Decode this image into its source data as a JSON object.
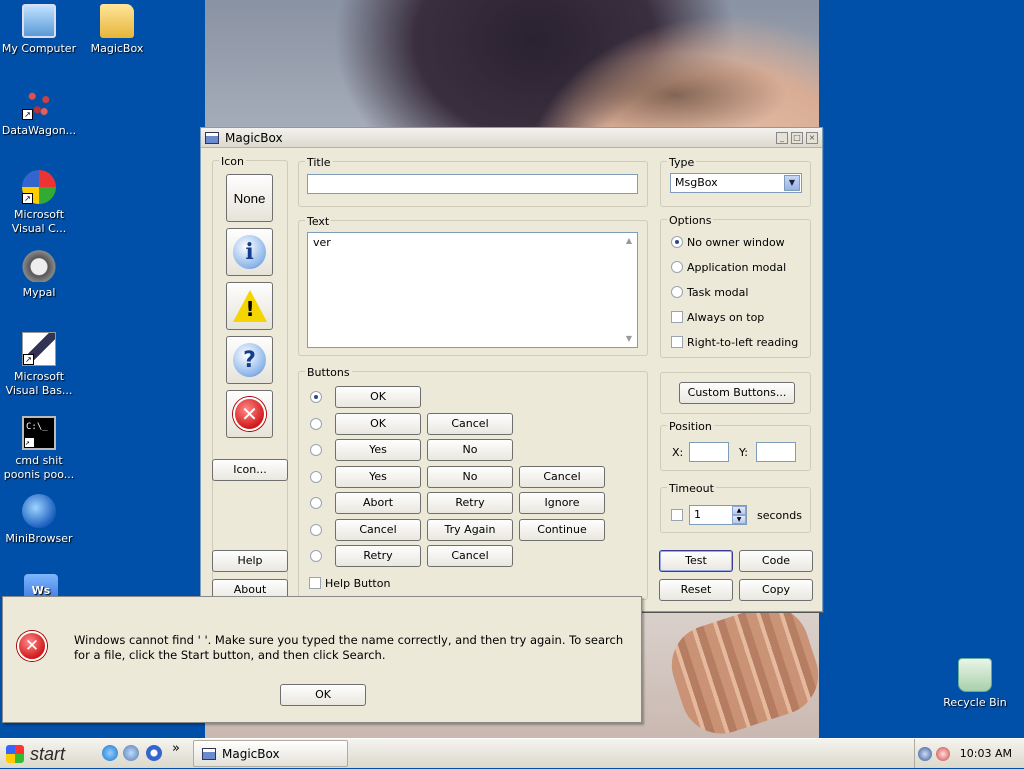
{
  "desktop": {
    "icons": [
      {
        "label": "My Computer",
        "icon": "computer-icon"
      },
      {
        "label": "MagicBox",
        "icon": "folder-icon"
      },
      {
        "label": "DataWagon...",
        "icon": "datawagon-icon"
      },
      {
        "label": "Microsoft Visual C...",
        "icon": "msvc-icon"
      },
      {
        "label": "Mypal",
        "icon": "mypal-icon"
      },
      {
        "label": "Microsoft Visual Bas...",
        "icon": "vb-icon"
      },
      {
        "label": "cmd shit poonis poo...",
        "icon": "cmd-icon"
      },
      {
        "label": "MiniBrowser",
        "icon": "minibrowser-icon"
      },
      {
        "label": "Recycle Bin",
        "icon": "recycle-bin-icon"
      }
    ],
    "cmd_glyph": "C:\\_"
  },
  "window": {
    "title": "MagicBox",
    "controls": {
      "minimize": "_",
      "maximize": "□",
      "close": "×"
    },
    "icon_group": {
      "label": "Icon",
      "none_label": "None",
      "info_glyph": "i",
      "warning_glyph": "!",
      "question_glyph": "?",
      "error_glyph": "✕",
      "icon_button": "Icon...",
      "help_button": "Help",
      "about_button": "About"
    },
    "title_group": {
      "label": "Title",
      "value": ""
    },
    "text_group": {
      "label": "Text",
      "value": "ver"
    },
    "type_group": {
      "label": "Type",
      "value": "MsgBox"
    },
    "options": {
      "label": "Options",
      "items": [
        {
          "label": "No owner window",
          "kind": "radio",
          "checked": true
        },
        {
          "label": "Application modal",
          "kind": "radio",
          "checked": false
        },
        {
          "label": "Task modal",
          "kind": "radio",
          "checked": false
        },
        {
          "label": "Always on top",
          "kind": "checkbox",
          "checked": false
        },
        {
          "label": "Right-to-left reading",
          "kind": "checkbox",
          "checked": false
        }
      ]
    },
    "buttons_group": {
      "label": "Buttons",
      "rows": [
        [
          "OK"
        ],
        [
          "OK",
          "Cancel"
        ],
        [
          "Yes",
          "No"
        ],
        [
          "Yes",
          "No",
          "Cancel"
        ],
        [
          "Abort",
          "Retry",
          "Ignore"
        ],
        [
          "Cancel",
          "Try Again",
          "Continue"
        ],
        [
          "Retry",
          "Cancel"
        ]
      ],
      "selected_row": 0,
      "help_button_label": "Help Button"
    },
    "custom_buttons": "Custom Buttons...",
    "position": {
      "label": "Position",
      "x_label": "X:",
      "y_label": "Y:",
      "x": "",
      "y": ""
    },
    "timeout": {
      "label": "Timeout",
      "value": "1",
      "unit": "seconds"
    },
    "actions": {
      "test": "Test",
      "code": "Code",
      "reset": "Reset",
      "copy": "Copy"
    }
  },
  "dialog": {
    "message": "Windows cannot find '     '. Make sure you typed the name correctly, and then try again. To search for a file, click the Start button, and then click Search.",
    "ok": "OK",
    "error_glyph": "✕"
  },
  "taskbar": {
    "start": "start",
    "chevron": "»",
    "task": "MagicBox",
    "clock": "10:03 AM"
  },
  "colors": {
    "desktop": "#004fa8",
    "window_face": "#ece9d8",
    "border": "#7f9db9"
  }
}
